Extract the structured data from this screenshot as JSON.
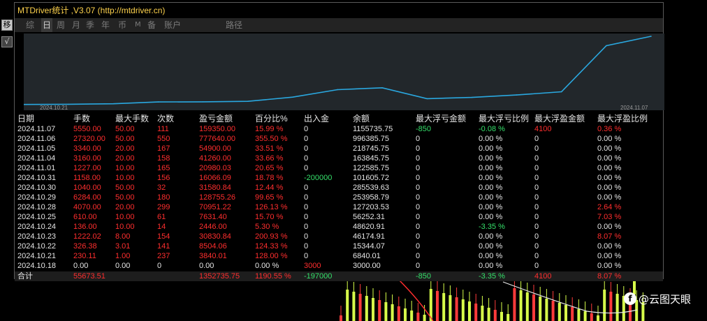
{
  "window_title": "MTDriver统计 ,V3.07 (http://mtdriver.cn)",
  "left_strip": {
    "btn1": "移",
    "btn2": "√"
  },
  "tabs": [
    "综",
    "日",
    "周",
    "月",
    "季",
    "年",
    "币",
    "M",
    "备",
    "账户",
    "路径"
  ],
  "active_tab": "日",
  "chart_data": {
    "type": "line",
    "x_start_label": "2024.10.21",
    "x_end_label": "2024.11.07",
    "x": [
      "2024.10.18",
      "2024.10.21",
      "2024.10.22",
      "2024.10.23",
      "2024.10.24",
      "2024.10.25",
      "2024.10.28",
      "2024.10.29",
      "2024.10.30",
      "2024.10.31",
      "2024.11.01",
      "2024.11.04",
      "2024.11.05",
      "2024.11.06",
      "2024.11.07"
    ],
    "values": [
      3000,
      6840.01,
      15344.07,
      46174.91,
      48620.91,
      56252.31,
      127203.53,
      253958.79,
      285539.63,
      101605.72,
      122585.75,
      163845.75,
      218745.75,
      996385.75,
      1155735.75
    ],
    "color": "#2aa8e0",
    "grid": false
  },
  "table": {
    "headers": [
      "日期",
      "手数",
      "最大手数",
      "次数",
      "盈亏金额",
      "百分比%",
      "出入金",
      "余额",
      "最大浮亏金额",
      "最大浮亏比例",
      "最大浮盈金额",
      "最大浮盈比例"
    ],
    "rows": [
      [
        "2024.11.07",
        "5550.00",
        "50.00",
        "111",
        "159350.00",
        "15.99 %",
        "0",
        "1155735.75",
        "-850",
        "-0.08 %",
        "4100",
        "0.36 %"
      ],
      [
        "2024.11.06",
        "27320.00",
        "50.00",
        "550",
        "777640.00",
        "355.50 %",
        "0",
        "996385.75",
        "0",
        "0.00 %",
        "0",
        "0.00 %"
      ],
      [
        "2024.11.05",
        "3340.00",
        "20.00",
        "167",
        "54900.00",
        "33.51 %",
        "0",
        "218745.75",
        "0",
        "0.00 %",
        "0",
        "0.00 %"
      ],
      [
        "2024.11.04",
        "3160.00",
        "20.00",
        "158",
        "41260.00",
        "33.66 %",
        "0",
        "163845.75",
        "0",
        "0.00 %",
        "0",
        "0.00 %"
      ],
      [
        "2024.11.01",
        "1227.00",
        "10.00",
        "165",
        "20980.03",
        "20.65 %",
        "0",
        "122585.75",
        "0",
        "0.00 %",
        "0",
        "0.00 %"
      ],
      [
        "2024.10.31",
        "1158.00",
        "10.00",
        "156",
        "16066.09",
        "18.78 %",
        "-200000",
        "101605.72",
        "0",
        "0.00 %",
        "0",
        "0.00 %"
      ],
      [
        "2024.10.30",
        "1040.00",
        "50.00",
        "32",
        "31580.84",
        "12.44 %",
        "0",
        "285539.63",
        "0",
        "0.00 %",
        "0",
        "0.00 %"
      ],
      [
        "2024.10.29",
        "6284.00",
        "50.00",
        "180",
        "128755.26",
        "99.65 %",
        "0",
        "253958.79",
        "0",
        "0.00 %",
        "0",
        "0.00 %"
      ],
      [
        "2024.10.28",
        "4070.00",
        "20.00",
        "299",
        "70951.22",
        "126.13 %",
        "0",
        "127203.53",
        "0",
        "0.00 %",
        "0",
        "2.64 %"
      ],
      [
        "2024.10.25",
        "610.00",
        "10.00",
        "61",
        "7631.40",
        "15.70 %",
        "0",
        "56252.31",
        "0",
        "0.00 %",
        "0",
        "7.03 %"
      ],
      [
        "2024.10.24",
        "136.00",
        "10.00",
        "14",
        "2446.00",
        "5.30 %",
        "0",
        "48620.91",
        "0",
        "-3.35 %",
        "0",
        "0.00 %"
      ],
      [
        "2024.10.23",
        "1222.02",
        "8.00",
        "154",
        "30830.84",
        "200.93 %",
        "0",
        "46174.91",
        "0",
        "0.00 %",
        "0",
        "8.07 %"
      ],
      [
        "2024.10.22",
        "326.38",
        "3.01",
        "141",
        "8504.06",
        "124.33 %",
        "0",
        "15344.07",
        "0",
        "0.00 %",
        "0",
        "0.00 %"
      ],
      [
        "2024.10.21",
        "230.11",
        "1.00",
        "237",
        "3840.01",
        "128.00 %",
        "0",
        "6840.01",
        "0",
        "0.00 %",
        "0",
        "0.00 %"
      ],
      [
        "2024.10.18",
        "0.00",
        "0.00",
        "0",
        "0.00",
        "0.00 %",
        "3000",
        "3000.00",
        "0",
        "0.00 %",
        "0",
        "0.00 %"
      ]
    ],
    "row_colors": [
      [
        "w",
        "r",
        "r",
        "r",
        "r",
        "r",
        "w",
        "w",
        "g",
        "g",
        "r",
        "r"
      ],
      [
        "w",
        "r",
        "r",
        "r",
        "r",
        "r",
        "w",
        "w",
        "w",
        "w",
        "w",
        "w"
      ],
      [
        "w",
        "r",
        "r",
        "r",
        "r",
        "r",
        "w",
        "w",
        "w",
        "w",
        "w",
        "w"
      ],
      [
        "w",
        "r",
        "r",
        "r",
        "r",
        "r",
        "w",
        "w",
        "w",
        "w",
        "w",
        "w"
      ],
      [
        "w",
        "r",
        "r",
        "r",
        "r",
        "r",
        "w",
        "w",
        "w",
        "w",
        "w",
        "w"
      ],
      [
        "w",
        "r",
        "r",
        "r",
        "r",
        "r",
        "g",
        "w",
        "w",
        "w",
        "w",
        "w"
      ],
      [
        "w",
        "r",
        "r",
        "r",
        "r",
        "r",
        "w",
        "w",
        "w",
        "w",
        "w",
        "w"
      ],
      [
        "w",
        "r",
        "r",
        "r",
        "r",
        "r",
        "w",
        "w",
        "w",
        "w",
        "w",
        "w"
      ],
      [
        "w",
        "r",
        "r",
        "r",
        "r",
        "r",
        "w",
        "w",
        "w",
        "w",
        "w",
        "r"
      ],
      [
        "w",
        "r",
        "r",
        "r",
        "r",
        "r",
        "w",
        "w",
        "w",
        "w",
        "w",
        "r"
      ],
      [
        "w",
        "r",
        "r",
        "r",
        "r",
        "r",
        "w",
        "w",
        "w",
        "g",
        "w",
        "w"
      ],
      [
        "w",
        "r",
        "r",
        "r",
        "r",
        "r",
        "w",
        "w",
        "w",
        "w",
        "w",
        "r"
      ],
      [
        "w",
        "r",
        "r",
        "r",
        "r",
        "r",
        "w",
        "w",
        "w",
        "w",
        "w",
        "w"
      ],
      [
        "w",
        "r",
        "r",
        "r",
        "r",
        "r",
        "w",
        "w",
        "w",
        "w",
        "w",
        "w"
      ],
      [
        "w",
        "w",
        "w",
        "w",
        "w",
        "w",
        "r",
        "w",
        "w",
        "w",
        "w",
        "w"
      ]
    ],
    "summary": [
      "合计",
      "55673.51",
      "",
      "",
      "1352735.75",
      "1190.55 %",
      "-197000",
      "",
      "-850",
      "-3.35 %",
      "4100",
      "8.07 %"
    ],
    "summary_colors": [
      "w",
      "r",
      "w",
      "w",
      "r",
      "r",
      "g",
      "w",
      "g",
      "g",
      "r",
      "r"
    ]
  },
  "colors": {
    "red": "#ff2e2e",
    "green": "#35e06a",
    "line": "#2aa8e0",
    "title": "#ffd34d"
  },
  "watermark": "@云图天眼"
}
